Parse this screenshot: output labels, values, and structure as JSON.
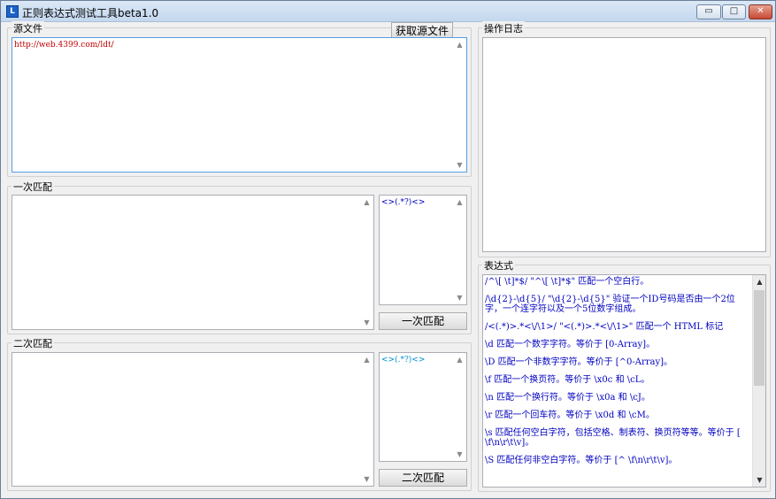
{
  "window": {
    "title": "正则表达式测试工具beta1.0",
    "icon": "app-icon",
    "controls": {
      "minimize": "▭",
      "maximize": "□",
      "close": "✕"
    }
  },
  "source": {
    "label": "源文件",
    "fetch_button": "获取源文件",
    "text": "http://web.4399.com/ldt/"
  },
  "log": {
    "label": "操作日志",
    "text": ""
  },
  "match1": {
    "label": "一次匹配",
    "result": "",
    "pattern": "<>(.*?)<>",
    "button": "一次匹配"
  },
  "match2": {
    "label": "二次匹配",
    "result": "",
    "pattern": "<>(.*?)<>",
    "button": "二次匹配"
  },
  "expressions": {
    "label": "表达式",
    "items": [
      "/^\\[ \\t]*$/ \"^\\[ \\t]*$\" 匹配一个空白行。",
      "/\\d{2}-\\d{5}/ \"\\d{2}-\\d{5}\" 验证一个ID号码是否由一个2位字，一个连字符以及一个5位数字组成。",
      "/<(.*)>.*<\\/\\1>/ \"<(.*)>.*<\\/\\1>\" 匹配一个 HTML 标记",
      "\\d 匹配一个数字字符。等价于 [0-Array]。",
      "\\D 匹配一个非数字字符。等价于 [^0-Array]。",
      "\\f 匹配一个换页符。等价于 \\x0c 和 \\cL。",
      "\\n 匹配一个换行符。等价于 \\x0a 和 \\cJ。",
      "\\r 匹配一个回车符。等价于 \\x0d 和 \\cM。",
      "\\s 匹配任何空白字符，包括空格、制表符、换页符等等。等价于 [ \\f\\n\\r\\t\\v]。",
      "\\S 匹配任何非空白字符。等价于 [^ \\f\\n\\r\\t\\v]。"
    ]
  },
  "scroll": {
    "up": "▲",
    "down": "▼"
  }
}
